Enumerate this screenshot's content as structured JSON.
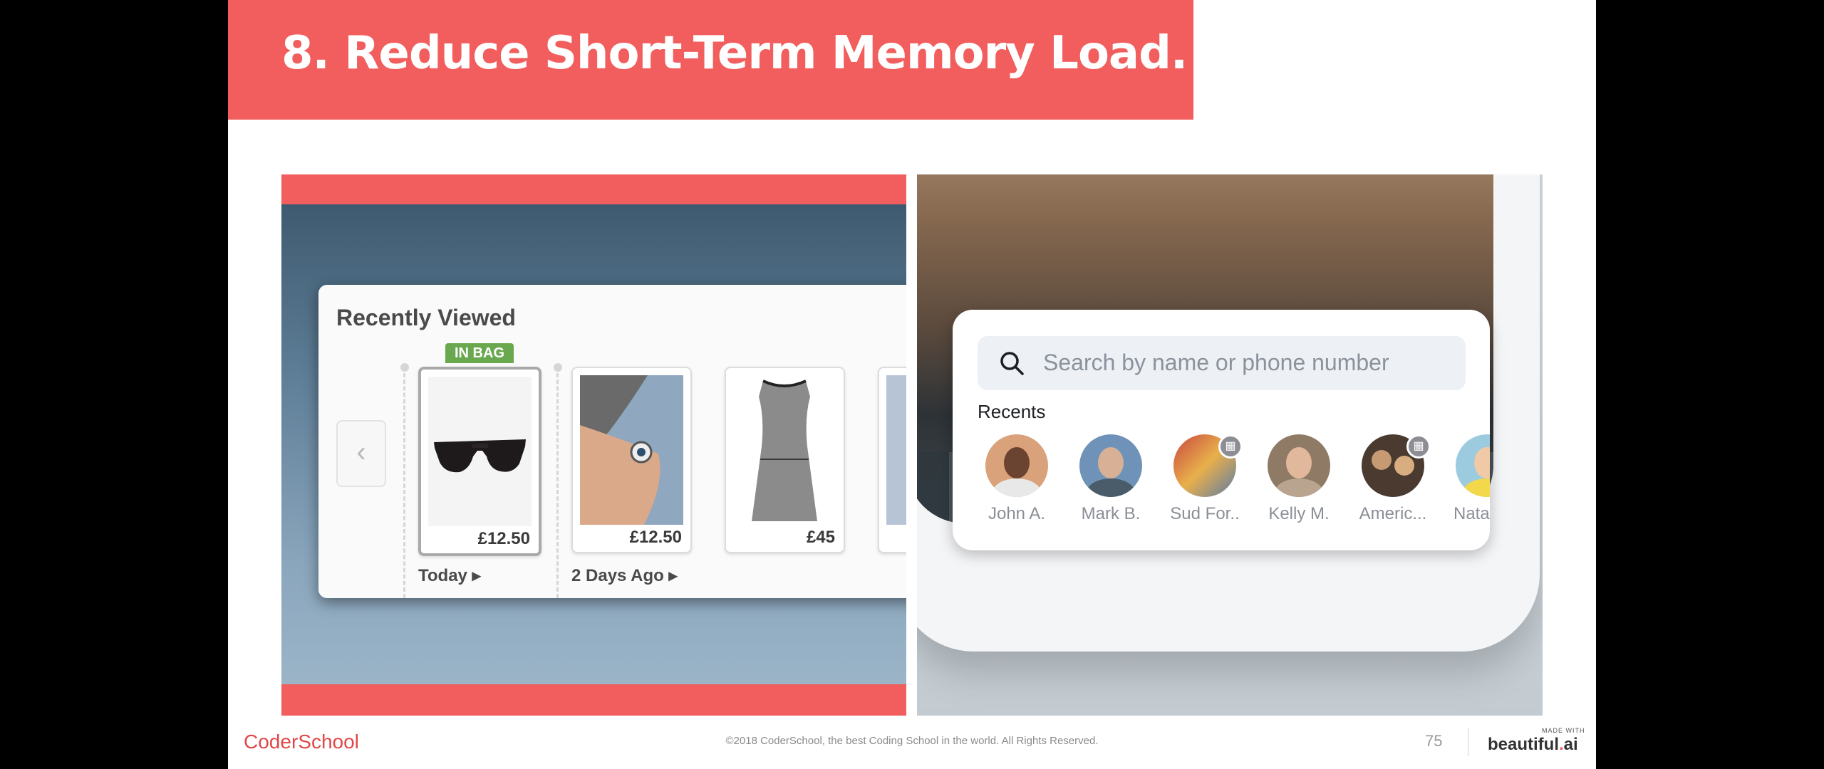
{
  "slide": {
    "title": "8. Reduce Short-Term Memory Load."
  },
  "recently_viewed": {
    "title": "Recently Viewed",
    "prev_arrow": "‹",
    "badge": "IN BAG",
    "items": [
      {
        "name": "sunglasses",
        "price": "£12.50",
        "in_bag": true
      },
      {
        "name": "watch",
        "price": "£12.50",
        "in_bag": false
      },
      {
        "name": "dress",
        "price": "£45",
        "in_bag": false
      }
    ],
    "groups": [
      {
        "label": "Today ▸"
      },
      {
        "label": "2 Days Ago ▸"
      }
    ]
  },
  "phone_search": {
    "placeholder": "Search by name or phone number",
    "recents_label": "Recents",
    "contacts": [
      {
        "name": "John A.",
        "business": false
      },
      {
        "name": "Mark B.",
        "business": false
      },
      {
        "name": "Sud For..",
        "business": true
      },
      {
        "name": "Kelly M.",
        "business": false
      },
      {
        "name": "Americ...",
        "business": true
      },
      {
        "name": "Nata",
        "business": false
      }
    ]
  },
  "footer": {
    "logo": "CoderSchool",
    "copyright": "©2018 CoderSchool, the best Coding School in the world. All Rights Reserved.",
    "page_number": "75",
    "made_with": "MADE WITH",
    "brand_main": "beautiful",
    "brand_dot": ".",
    "brand_suffix": "ai"
  },
  "colors": {
    "accent": "#f25d5d",
    "in_bag_green": "#6aa84f"
  }
}
